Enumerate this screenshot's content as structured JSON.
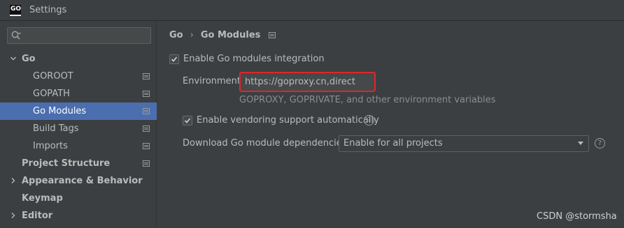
{
  "window": {
    "title": "Settings",
    "app_icon_text": "GO"
  },
  "sidebar": {
    "search": {
      "placeholder": "",
      "value": ""
    },
    "items": [
      {
        "label": "Go",
        "level": 0,
        "expanded": true,
        "bold": true
      },
      {
        "label": "GOROOT",
        "level": 1
      },
      {
        "label": "GOPATH",
        "level": 1
      },
      {
        "label": "Go Modules",
        "level": 1,
        "selected": true
      },
      {
        "label": "Build Tags",
        "level": 1
      },
      {
        "label": "Imports",
        "level": 1
      },
      {
        "label": "Project Structure",
        "level": 0,
        "bold": true
      },
      {
        "label": "Appearance & Behavior",
        "level": 0,
        "bold": true,
        "collapsed": true
      },
      {
        "label": "Keymap",
        "level": 0,
        "bold": true
      },
      {
        "label": "Editor",
        "level": 0,
        "bold": true,
        "collapsed": true
      }
    ]
  },
  "main": {
    "breadcrumb": [
      "Go",
      "Go Modules"
    ],
    "enable_modules": {
      "label": "Enable Go modules integration",
      "checked": true
    },
    "environment": {
      "label": "Environment:",
      "value": "https://goproxy.cn,direct",
      "hint": "GOPROXY, GOPRIVATE, and other environment variables"
    },
    "vendoring": {
      "label": "Enable vendoring support automatically",
      "checked": true,
      "help": "?"
    },
    "download": {
      "label": "Download Go module dependencies:",
      "selected": "Enable for all projects",
      "help": "?"
    }
  },
  "watermark": "CSDN @stormsha",
  "colors": {
    "background": "#3c3f41",
    "selection": "#4b6eaf",
    "highlight_border": "#e0252b",
    "text": "#bbbbbb"
  }
}
